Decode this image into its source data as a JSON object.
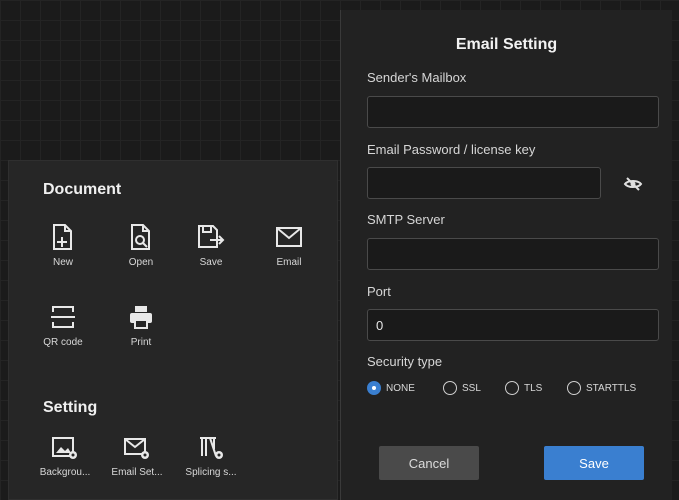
{
  "document_section": {
    "title": "Document",
    "tools": [
      {
        "label": "New",
        "icon": "new-file-icon"
      },
      {
        "label": "Open",
        "icon": "open-file-icon"
      },
      {
        "label": "Save",
        "icon": "save-icon"
      },
      {
        "label": "Email",
        "icon": "email-icon"
      },
      {
        "label": "QR code",
        "icon": "qr-code-icon"
      },
      {
        "label": "Print",
        "icon": "print-icon"
      }
    ]
  },
  "setting_section": {
    "title": "Setting",
    "tools": [
      {
        "label": "Backgrou...",
        "icon": "background-settings-icon"
      },
      {
        "label": "Email Set...",
        "icon": "email-settings-icon"
      },
      {
        "label": "Splicing s...",
        "icon": "splicing-settings-icon"
      }
    ]
  },
  "email_setting": {
    "title": "Email Setting",
    "sender_label": "Sender's Mailbox",
    "sender_value": "",
    "password_label": "Email Password / license key",
    "password_value": "",
    "smtp_label": "SMTP Server",
    "smtp_value": "",
    "port_label": "Port",
    "port_value": "0",
    "security_label": "Security type",
    "security_options": [
      "NONE",
      "SSL",
      "TLS",
      "STARTTLS"
    ],
    "security_selected": "NONE",
    "cancel_label": "Cancel",
    "save_label": "Save"
  },
  "colors": {
    "accent": "#3a7fd0",
    "panel": "#222222",
    "cancel_button": "#4a4a4a"
  }
}
